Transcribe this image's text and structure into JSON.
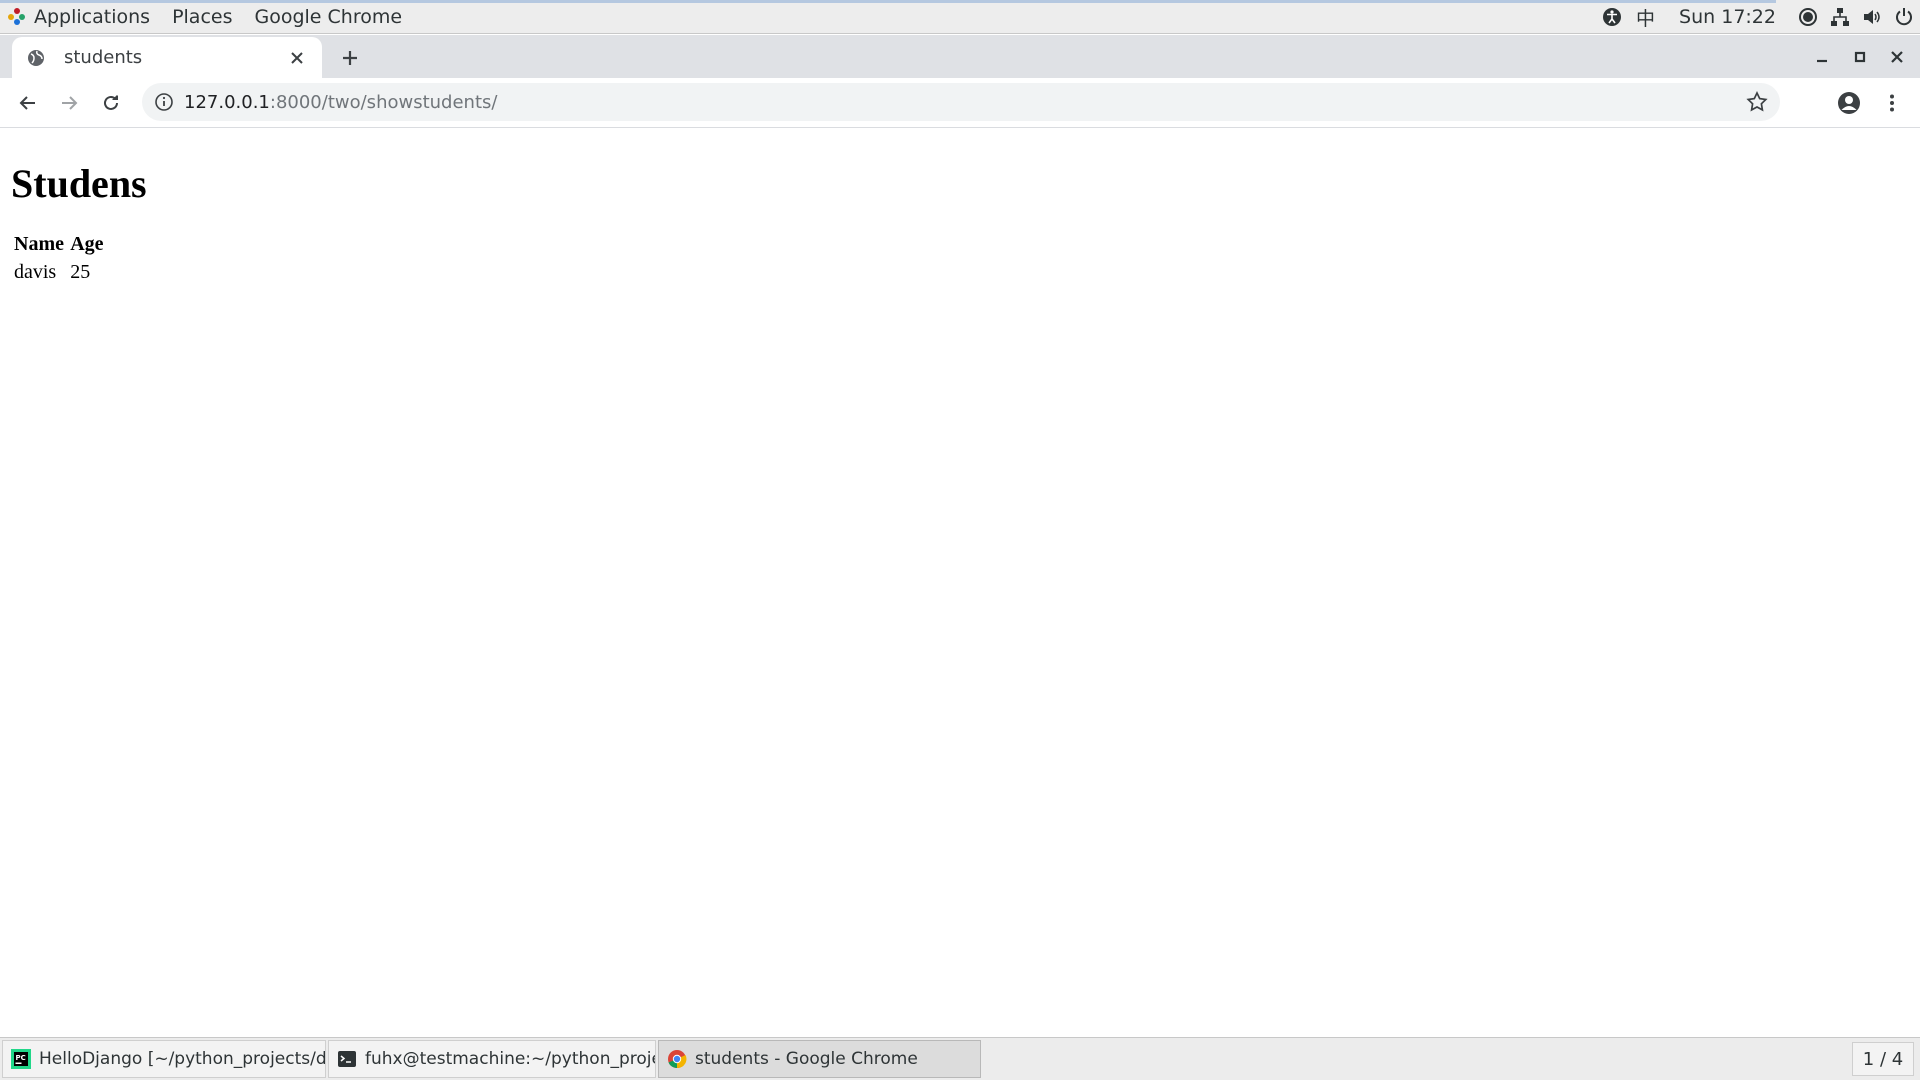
{
  "topbar": {
    "menus": [
      "Applications",
      "Places",
      "Google Chrome"
    ],
    "ime": "中",
    "clock": "Sun 17:22",
    "icons": [
      "accessibility-icon",
      "screen-record-icon",
      "network-icon",
      "volume-icon",
      "power-icon"
    ]
  },
  "browser": {
    "tab_title": "students",
    "url_host": "127.0.0.1",
    "url_rest": ":8000/two/showstudents/"
  },
  "page": {
    "heading": "Studens",
    "table": {
      "headers": [
        "Name",
        "Age"
      ],
      "rows": [
        [
          "davis",
          "25"
        ]
      ]
    }
  },
  "taskbar": {
    "tasks": [
      {
        "label": "HelloDjango [~/python_projects/djan...",
        "icon": "pycharm-icon"
      },
      {
        "label": "fuhx@testmachine:~/python_project...",
        "icon": "terminal-icon"
      },
      {
        "label": "students - Google Chrome",
        "icon": "chrome-icon"
      }
    ],
    "workspace": "1 / 4"
  },
  "colors": {
    "topbar_bg": "#ededed",
    "tabstrip_bg": "#dfe1e5",
    "omnibox_bg": "#f1f3f4",
    "taskbar_bg": "#ececec"
  }
}
